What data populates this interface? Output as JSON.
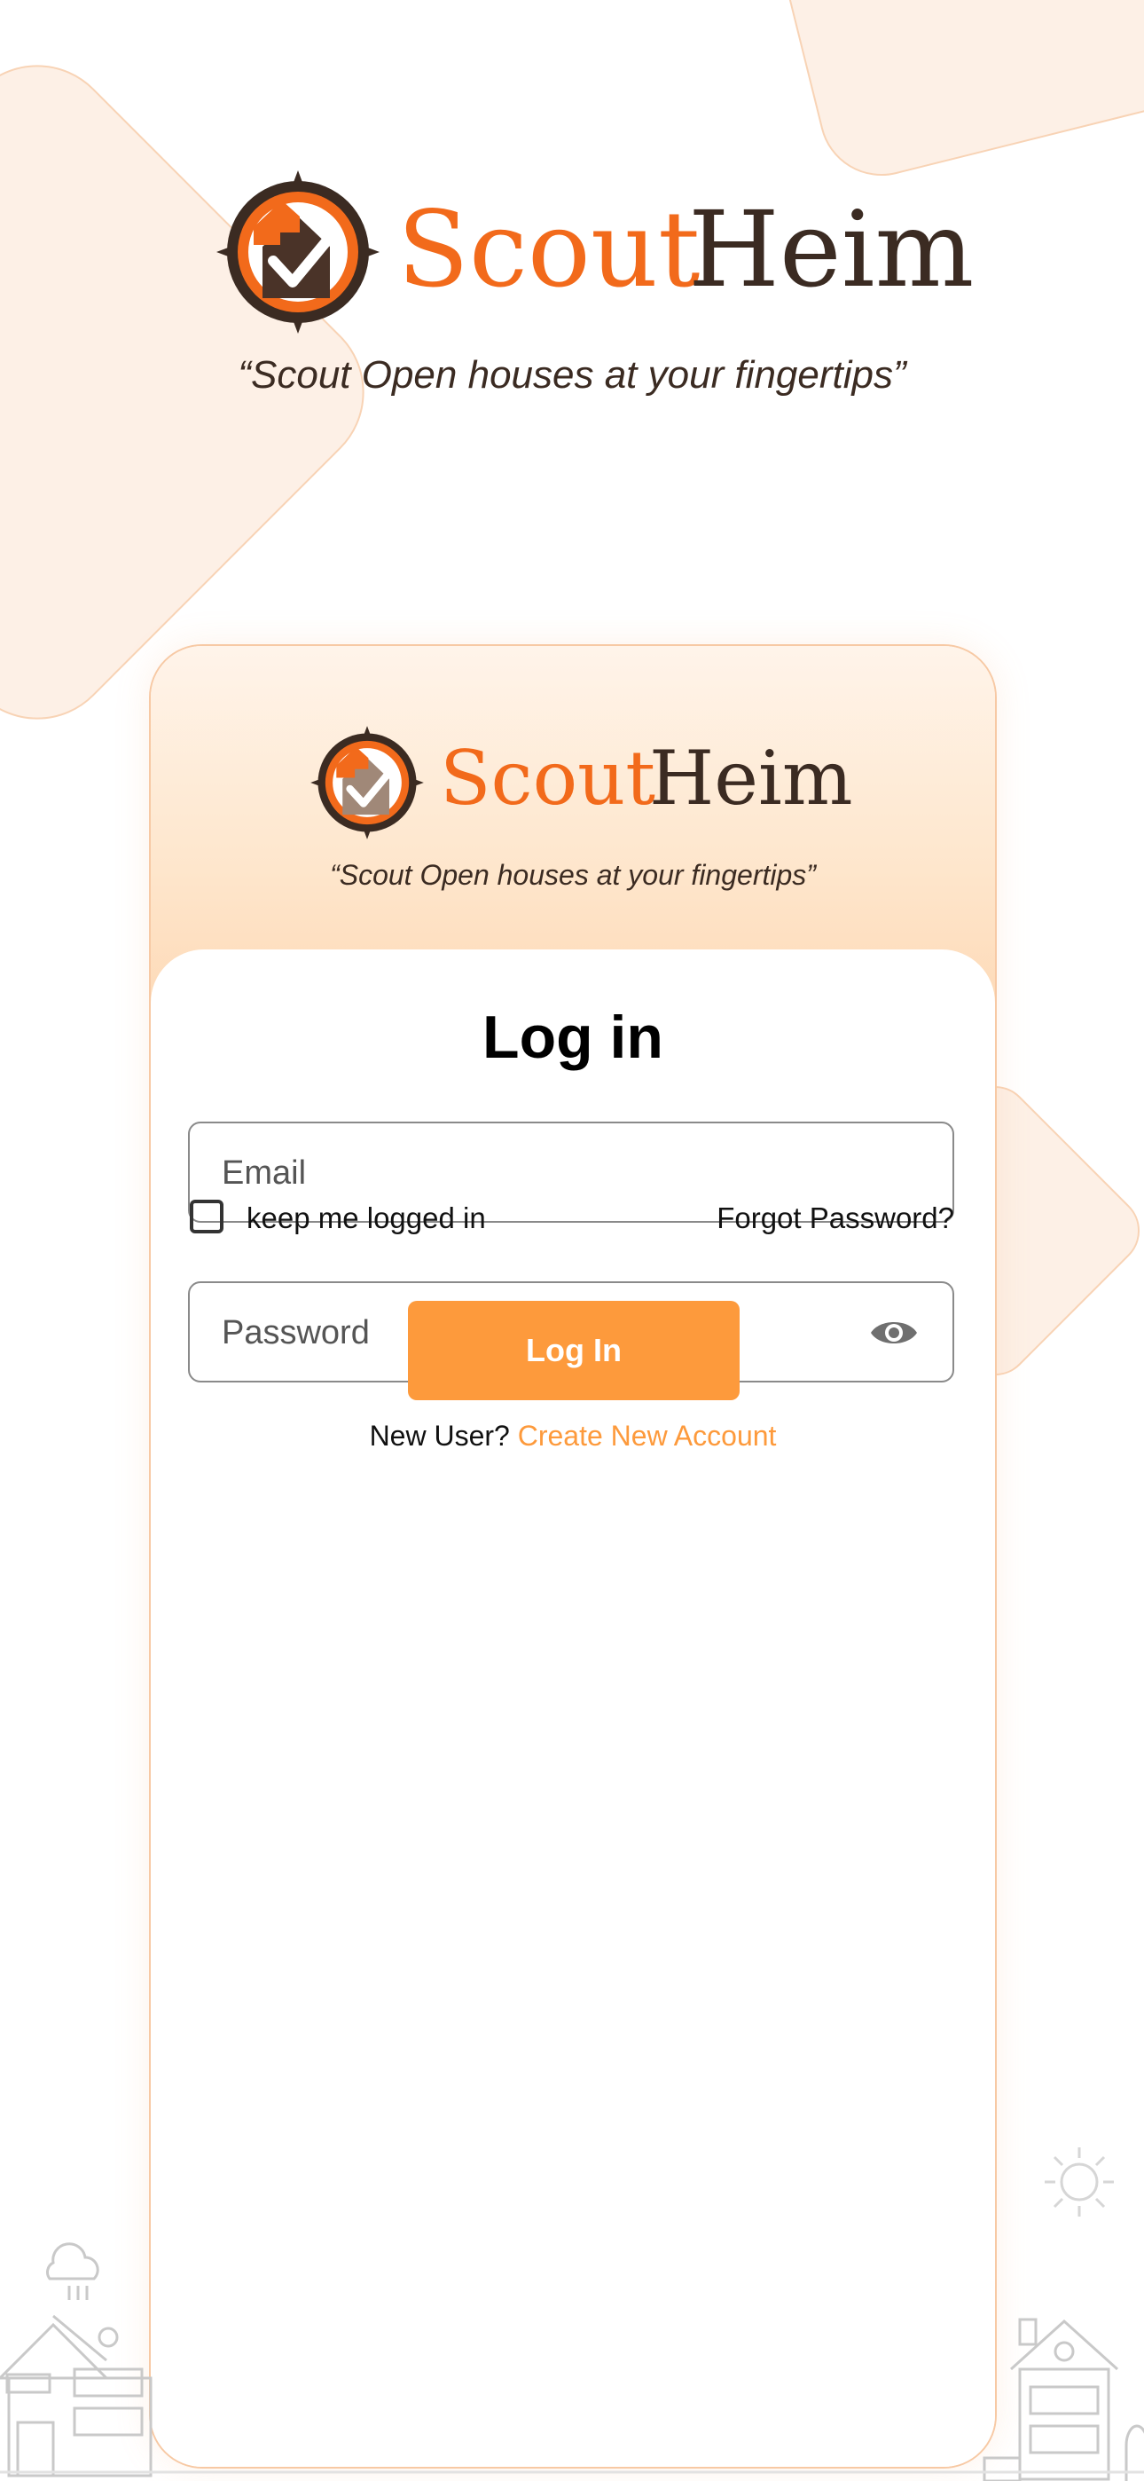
{
  "brand": {
    "word_orange": "Scout",
    "word_dark": "Heim",
    "tagline": "“Scout Open houses at your fingertips”"
  },
  "card": {
    "brand": {
      "word_orange": "Scout",
      "word_dark": "Heim",
      "tagline": "“Scout Open houses at your fingertips”"
    },
    "title": "Log in",
    "email": {
      "placeholder": "Email",
      "value": ""
    },
    "password": {
      "placeholder": "Password",
      "value": ""
    },
    "remember_label": "keep me logged in",
    "forgot_label": "Forgot Password?",
    "login_button": "Log In",
    "new_user_text": "New User?",
    "create_account_link": "Create New Account"
  },
  "icons": {
    "logo": "compass-house-check-logo",
    "eye": "eye-icon"
  },
  "colors": {
    "brand_orange": "#f26a1b",
    "brand_dark": "#3b2b22",
    "button": "#fd9a3c",
    "link": "#fd9a3c",
    "header_gradient_end": "#fdd9b6"
  }
}
